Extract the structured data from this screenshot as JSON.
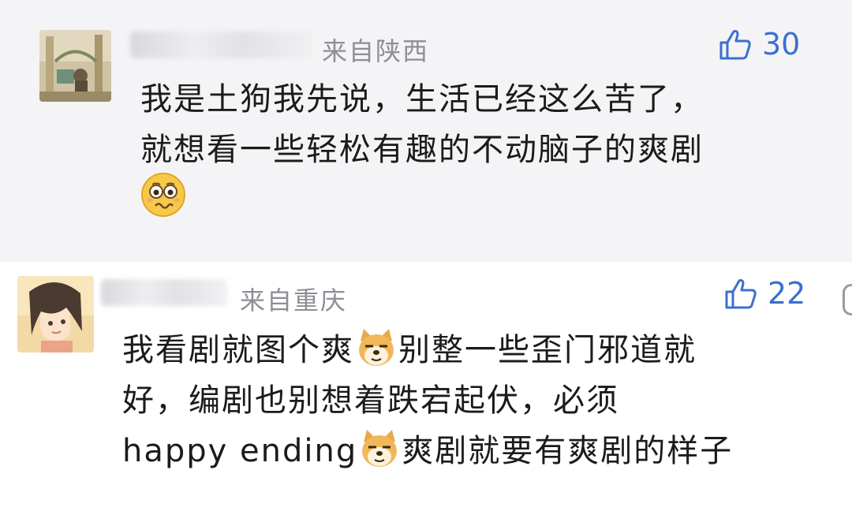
{
  "comments": [
    {
      "location": "来自陕西",
      "likes": "30",
      "lines": [
        "我是土狗我先说，生活已经这么苦了，",
        "就想看一些轻松有趣的不动脑子的爽剧"
      ]
    },
    {
      "location": "来自重庆",
      "likes": "22",
      "line1_a": "我看剧就图个爽",
      "line1_b": "别整一些歪门邪道就",
      "line2": "好，编剧也别想着跌宕起伏，必须",
      "line3_a": "happy ending",
      "line3_b": "爽剧就要有爽剧的样子"
    }
  ],
  "icons": {
    "like": "thumbs-up-icon",
    "face_emoji": "worried-face-emoji",
    "doge_emoji": "doge-emoji"
  },
  "colors": {
    "like_blue": "#3c6fd0",
    "location_gray": "#8e8e95",
    "top_bg": "#f4f4f6"
  }
}
